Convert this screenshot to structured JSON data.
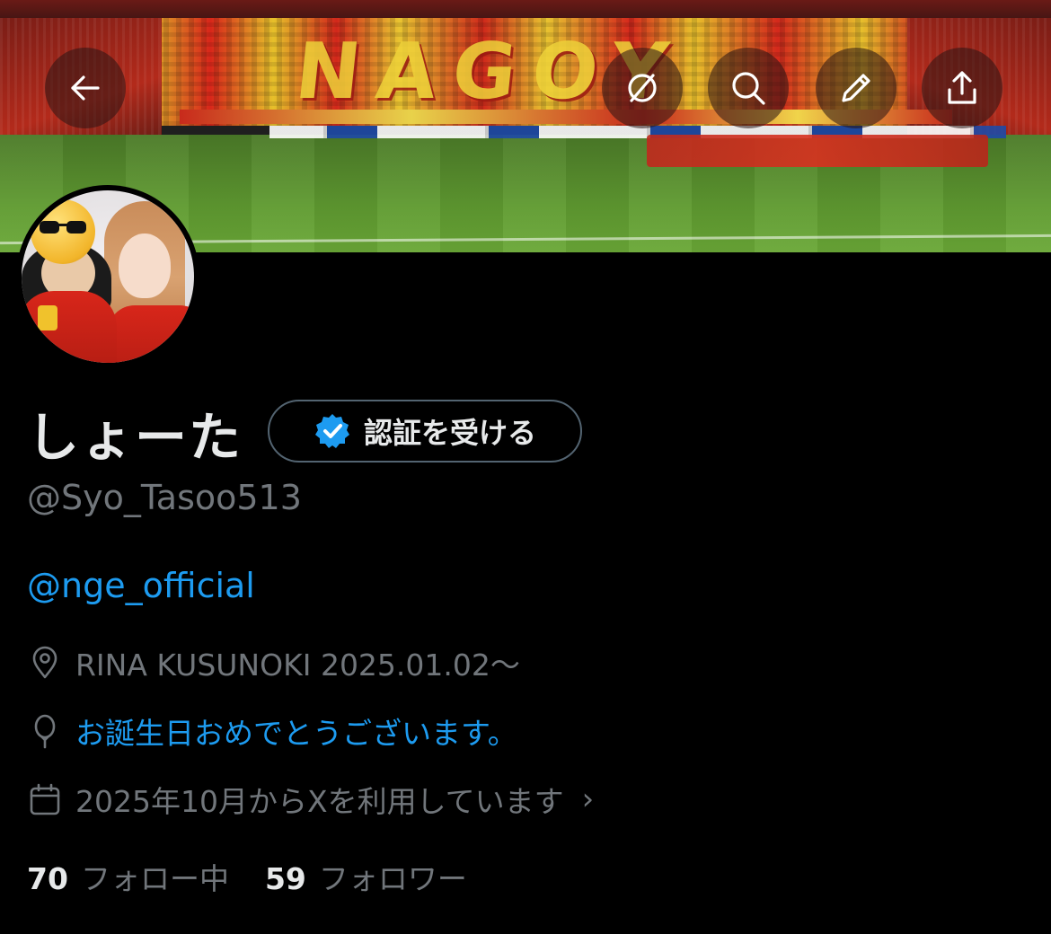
{
  "header": {
    "banner_text": "NAGOY",
    "buttons": {
      "back_icon": "arrow-left-icon",
      "grok_icon": "slashed-circle-icon",
      "search_icon": "search-icon",
      "edit_icon": "pencil-icon",
      "share_icon": "share-upload-icon"
    }
  },
  "profile": {
    "name": "しょーた",
    "verify_button_label": "認証を受ける",
    "handle": "@Syo_Tasoo513",
    "bio_link": "@nge_official",
    "location": "RINA KUSUNOKI 2025.01.02～",
    "birthday": "お誕生日おめでとうございます。",
    "joined": "2025年10月からXを利用しています",
    "joined_chevron": "›"
  },
  "stats": {
    "following_count": "70",
    "following_label": "フォロー中",
    "followers_count": "59",
    "followers_label": "フォロワー"
  },
  "colors": {
    "background": "#000000",
    "text_primary": "#e7e9ea",
    "text_secondary": "#71767b",
    "accent_blue": "#1d9bf0",
    "border": "#536471"
  }
}
